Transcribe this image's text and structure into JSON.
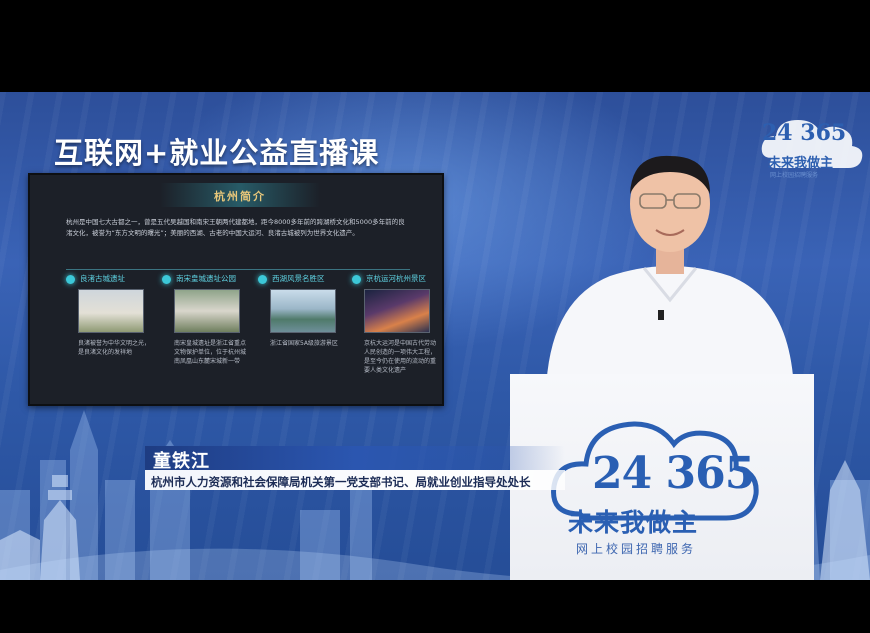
{
  "program": {
    "title": "互联网+就业公益直播课"
  },
  "brand": {
    "numbers": "24 365",
    "slogan": "未来我做主",
    "service": "网上校园招聘服务",
    "colors": {
      "primary": "#2a5fb3",
      "stage": "#3a63b6"
    }
  },
  "slide": {
    "heading": "杭州简介",
    "intro": "杭州是中国七大古都之一，曾是五代吴越国和南宋王朝两代建都地，距今8000多年前的跨湖桥文化和5000多年前的良渚文化，被誉为“东方文明的曙光”；美丽的西湖、古老的中国大运河、良渚古城被列为世界文化遗产。",
    "spots": [
      {
        "name": "良渚古城遗址",
        "desc": "良渚被誉为中华文明之光，是良渚文化的发祥地"
      },
      {
        "name": "南宋皇城遗址公园",
        "desc": "南宋皇城遗址是浙江省重点文物保护单位，位于杭州城南凤凰山东麓宋城新一带"
      },
      {
        "name": "西湖风景名胜区",
        "desc": "浙江省国家5A级旅游景区"
      },
      {
        "name": "京杭运河杭州景区",
        "desc": "京杭大运河是中国古代劳动人民创造的一项伟大工程，是至今仍在使用的流动的重要人类文化遗产"
      }
    ]
  },
  "speaker": {
    "name": "童铁江",
    "title": "杭州市人力资源和社会保障局机关第一党支部书记、局就业创业指导处处长"
  }
}
